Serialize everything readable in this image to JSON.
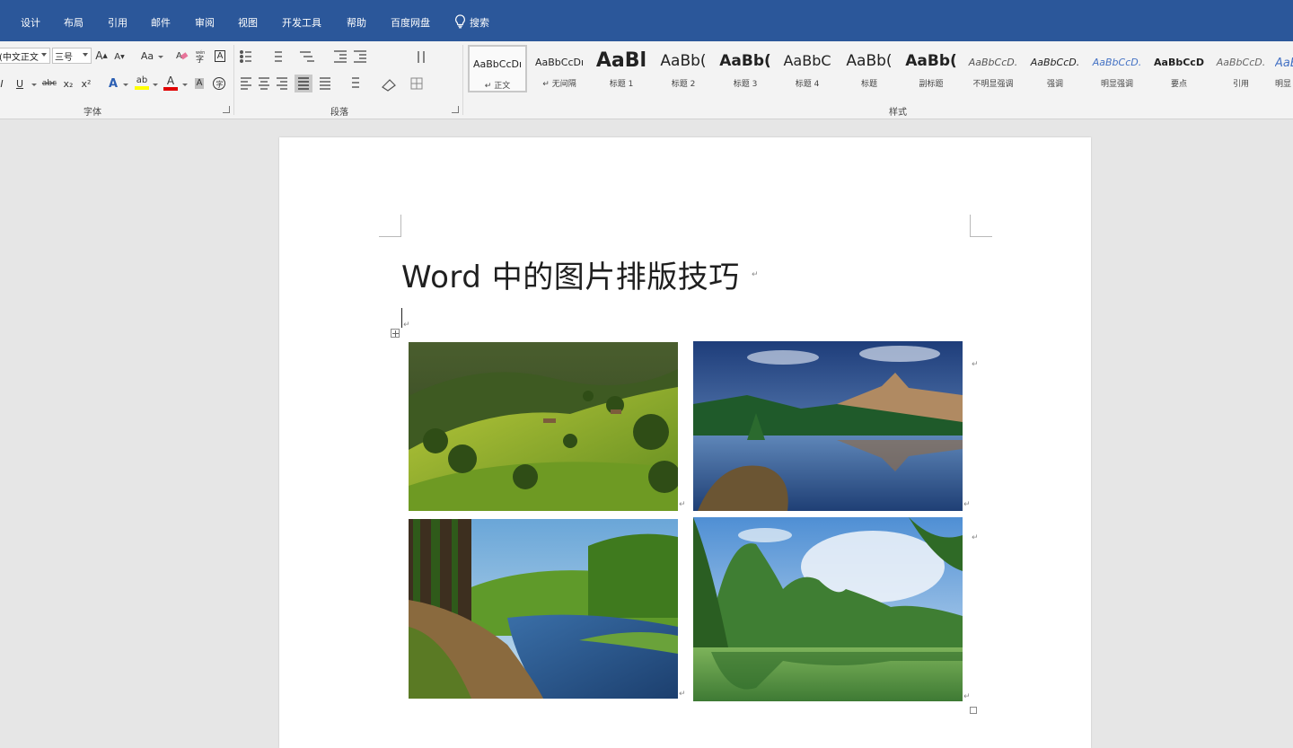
{
  "menubar": {
    "items": [
      "设计",
      "布局",
      "引用",
      "邮件",
      "审阅",
      "视图",
      "开发工具",
      "帮助",
      "百度网盘"
    ],
    "search_label": "搜索"
  },
  "ribbon": {
    "font": {
      "group_label": "字体",
      "font_name": "(中文正文",
      "font_size": "三号",
      "grow_label": "A",
      "shrink_label": "A",
      "case_label": "Aa",
      "italic_label": "I",
      "underline_label": "U",
      "strike_label": "abc",
      "subscript_label": "x₂",
      "superscript_label": "x²",
      "effects_label": "A",
      "highlight_label": "ab",
      "font_color_label": "A",
      "shade_label": "A",
      "enclose_label": "字",
      "phonetic_label": "wén",
      "border_label": "A",
      "highlight_color": "#ffff00",
      "font_color": "#e00000"
    },
    "paragraph": {
      "group_label": "段落"
    },
    "styles": {
      "group_label": "样式",
      "items": [
        {
          "sample": "AaBbCcDı",
          "name": "↵ 正文"
        },
        {
          "sample": "AaBbCcDı",
          "name": "↵ 无间隔"
        },
        {
          "sample": "AaBl",
          "name": "标题 1"
        },
        {
          "sample": "AaBb(",
          "name": "标题 2"
        },
        {
          "sample": "AaBb(",
          "name": "标题 3"
        },
        {
          "sample": "AaBbC",
          "name": "标题 4"
        },
        {
          "sample": "AaBb(",
          "name": "标题"
        },
        {
          "sample": "AaBb(",
          "name": "副标题"
        },
        {
          "sample": "AaBbCcD.",
          "name": "不明显强调"
        },
        {
          "sample": "AaBbCcD.",
          "name": "强调"
        },
        {
          "sample": "AaBbCcD.",
          "name": "明显强调"
        },
        {
          "sample": "AaBbCcD",
          "name": "要点"
        },
        {
          "sample": "AaBbCcD.",
          "name": "引用"
        },
        {
          "sample": "AaBl",
          "name": "明显"
        }
      ]
    }
  },
  "document": {
    "title": "Word 中的图片排版技巧",
    "para_mark": "↵",
    "images": [
      {
        "name": "green-hills-photo"
      },
      {
        "name": "mountain-lake-photo"
      },
      {
        "name": "forest-river-photo"
      },
      {
        "name": "karst-lake-photo"
      }
    ]
  },
  "colors": {
    "menubar_bg": "#2b579a",
    "ribbon_bg": "#f3f3f3",
    "workspace_bg": "#e6e6e6"
  }
}
